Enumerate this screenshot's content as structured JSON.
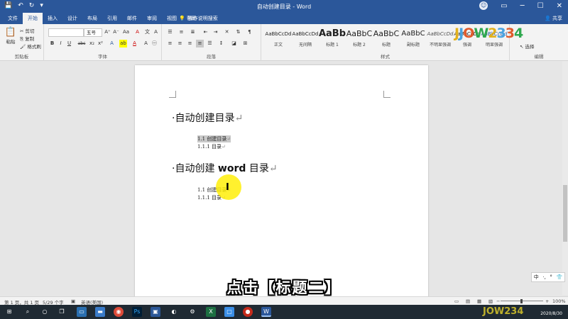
{
  "titlebar": {
    "title": "自动创建目录 - Word",
    "qat": {
      "save": "💾",
      "undo": "↶",
      "redo": "↻",
      "more": "▾"
    },
    "controls": {
      "minimize": "─",
      "maximize": "☐",
      "close": "✕",
      "ribbon_options": "▭"
    }
  },
  "tabs": [
    "文件",
    "开始",
    "插入",
    "设计",
    "布局",
    "引用",
    "邮件",
    "审阅",
    "视图",
    "帮助"
  ],
  "active_tab": "开始",
  "tellme": "操作说明搜索",
  "share": "共享",
  "ribbon": {
    "clipboard": {
      "paste": "粘贴",
      "cut": "剪切",
      "copy": "复制",
      "format_painter": "格式刷",
      "label": "剪贴板"
    },
    "font": {
      "font_name": "",
      "font_size": "五号",
      "label": "字体",
      "bold": "B",
      "italic": "I",
      "underline": "U",
      "strike": "abc",
      "sub": "x₂",
      "sup": "x²",
      "grow": "A⁺",
      "shrink": "A⁻",
      "case": "Aa",
      "clear": "A",
      "color": "A",
      "highlight": "ab"
    },
    "paragraph": {
      "label": "段落"
    },
    "styles": {
      "label": "样式",
      "items": [
        {
          "sample": "AaBbCcDd",
          "name": "正文"
        },
        {
          "sample": "AaBbCcDd",
          "name": "无间隔"
        },
        {
          "sample": "AaBb",
          "name": "标题 1"
        },
        {
          "sample": "AaBbC",
          "name": "标题 2"
        },
        {
          "sample": "AaBbC",
          "name": "标题"
        },
        {
          "sample": "AaBbC",
          "name": "副标题"
        },
        {
          "sample": "AaBbCcDd",
          "name": "不明显强调"
        },
        {
          "sample": "AaBbCcDd",
          "name": "强调"
        },
        {
          "sample": "AaBbCcDd",
          "name": "明显强调"
        }
      ]
    },
    "editing": {
      "select": "选择",
      "label": "编辑"
    }
  },
  "logo": "JJOW2334",
  "document": {
    "heading1": "自动创建目录",
    "toc1": "1.1 创建目录",
    "toc2": "1.1.1 目录",
    "heading2_prefix": "自动创建 ",
    "heading2_bold": "word",
    "heading2_suffix": " 目录",
    "toc3": "1.1 创建目录",
    "toc4": "1.1.1 目录",
    "bullet": "·",
    "para_mark": "↵",
    "ibeam": "I"
  },
  "sidewidget": {
    "ime": "中",
    "punct": "·,",
    "symbol": "°",
    "clothes": "👕"
  },
  "caption": "点击【标题二】",
  "statusbar": {
    "page": "第 1 页，共 1 页",
    "words": "5/29 个字",
    "lang": "英语(美国)",
    "zoom": "100%"
  },
  "taskbar": {
    "time": "",
    "date": "2020/8/30",
    "watermark": "JOW234"
  },
  "colors": {
    "word_blue": "#2b579a",
    "highlight_yellow": "#ffee00",
    "selection_gray": "#c9c9c9"
  }
}
